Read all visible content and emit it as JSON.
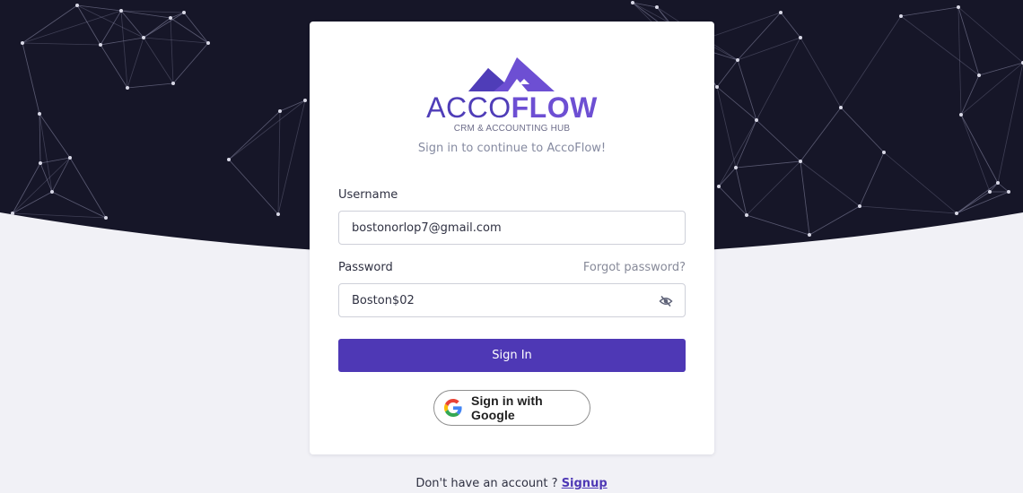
{
  "brand": {
    "name_part1": "ACCO",
    "name_part2": "FLOW",
    "tagline": "CRM & ACCOUNTING HUB",
    "colors": {
      "primary": "#4e38b5",
      "accent": "#6d4fd3"
    }
  },
  "subtitle": "Sign in to continue to AccoFlow!",
  "form": {
    "username_label": "Username",
    "username_value": "bostonorlop7@gmail.com",
    "password_label": "Password",
    "forgot_label": "Forgot password?",
    "password_value": "Boston$02",
    "visibility_icon": "eye-off-icon",
    "signin_label": "Sign In",
    "google_label": "Sign in with Google",
    "google_icon": "google-g-icon"
  },
  "footer": {
    "prompt": "Don't have an account ?",
    "signup_label": "Signup"
  },
  "background": {
    "dark": "#161628",
    "light": "#f1f1f6"
  }
}
